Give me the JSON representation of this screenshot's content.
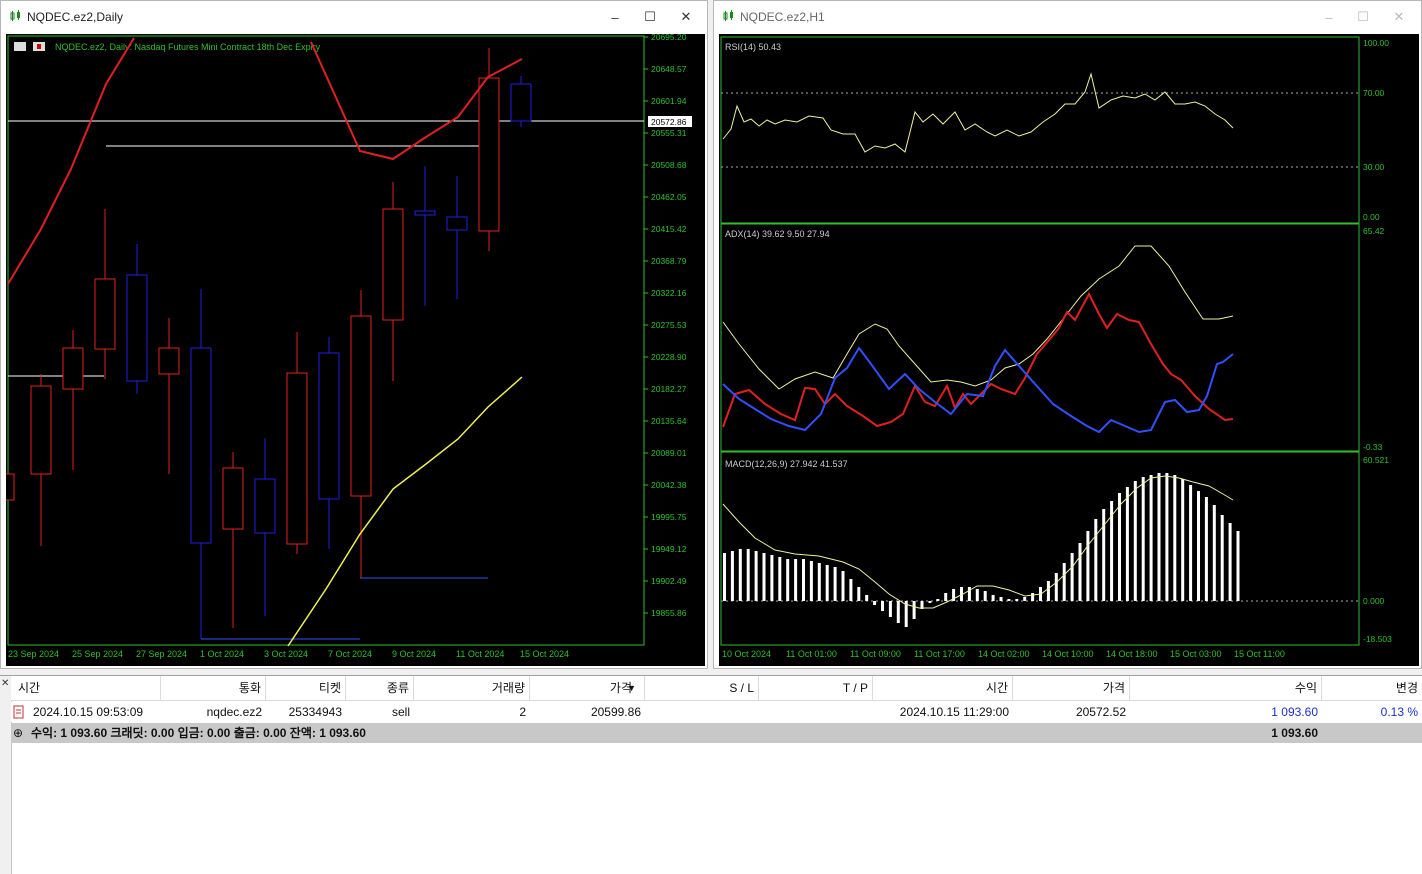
{
  "left_window": {
    "title": "NQDEC.ez2,Daily",
    "controls": {
      "minimize": "–",
      "maximize": "☐",
      "close": "✕"
    },
    "chart": {
      "header_text": "NQDEC.ez2, Daily:  Nasdaq Futures Mini Contract 18th Dec Expiry",
      "price_labels": [
        "20695.20",
        "20648.57",
        "20601.94",
        "20555.31",
        "20508.68",
        "20462.05",
        "20415.42",
        "20368.79",
        "20322.16",
        "20275.53",
        "20228.90",
        "20182.27",
        "20135.64",
        "20089.01",
        "20042.38",
        "19995.75",
        "19949.12",
        "19902.49",
        "19855.86"
      ],
      "current_price": "20572.86",
      "date_labels": [
        "23 Sep 2024",
        "25 Sep 2024",
        "27 Sep 2024",
        "1 Oct 2024",
        "3 Oct 2024",
        "7 Oct 2024",
        "9 Oct 2024",
        "11 Oct 2024",
        "15 Oct 2024"
      ],
      "colors": {
        "bull": "#e02020",
        "bear": "#2020e0",
        "ma_red": "#e02020",
        "ma_yellow": "#f0f050",
        "axis": "#2ec02e"
      }
    }
  },
  "right_window": {
    "title": "NQDEC.ez2,H1",
    "controls": {
      "minimize": "–",
      "maximize": "☐",
      "close": "✕"
    },
    "rsi": {
      "label": "RSI(14) 50.43",
      "scale": [
        "100.00",
        "70.00",
        "30.00",
        "0.00"
      ]
    },
    "adx": {
      "label": "ADX(14) 39.62 9.50 27.94",
      "scale": [
        "65.42",
        "-0.33"
      ]
    },
    "macd": {
      "label": "MACD(12,26,9) 27.942 41.537",
      "scale": [
        "60.521",
        "0.000",
        "-18.503"
      ]
    },
    "date_labels": [
      "10 Oct 2024",
      "11 Oct 01:00",
      "11 Oct 09:00",
      "11 Oct 17:00",
      "14 Oct 02:00",
      "14 Oct 10:00",
      "14 Oct 18:00",
      "15 Oct 03:00",
      "15 Oct 11:00"
    ]
  },
  "terminal": {
    "headers": {
      "time": "시간",
      "symbol": "통화",
      "ticket": "티켓",
      "type": "종류",
      "volume": "거래량",
      "price": "가격",
      "sl": "S / L",
      "tp": "T / P",
      "time2": "시간",
      "price2": "가격",
      "profit": "수익",
      "change": "변경"
    },
    "trade": {
      "time": "2024.10.15 09:53:09",
      "symbol": "nqdec.ez2",
      "ticket": "25334943",
      "type": "sell",
      "volume": "2",
      "price": "20599.86",
      "sl": "",
      "tp": "",
      "time2": "2024.10.15 11:29:00",
      "price2": "20572.52",
      "profit": "1 093.60",
      "change": "0.13 %"
    },
    "summary": {
      "text": "수익: 1 093.60  크래딧: 0.00  입금: 0.00  출금: 0.00  잔액: 1 093.60",
      "profit": "1 093.60"
    }
  }
}
